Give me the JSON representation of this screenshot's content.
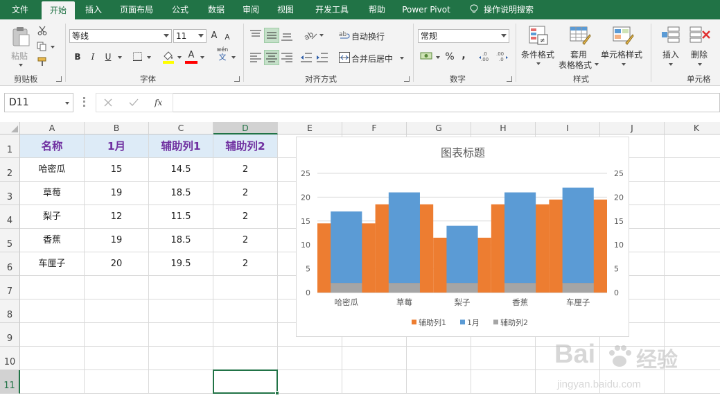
{
  "ribbon_tabs": [
    {
      "label": "文件",
      "active": false
    },
    {
      "label": "开始",
      "active": true
    },
    {
      "label": "插入",
      "active": false
    },
    {
      "label": "页面布局",
      "active": false
    },
    {
      "label": "公式",
      "active": false
    },
    {
      "label": "数据",
      "active": false
    },
    {
      "label": "审阅",
      "active": false
    },
    {
      "label": "视图",
      "active": false
    },
    {
      "label": "开发工具",
      "active": false
    },
    {
      "label": "帮助",
      "active": false
    },
    {
      "label": "Power Pivot",
      "active": false
    },
    {
      "label": "操作说明搜索",
      "active": false,
      "icon": "lightbulb-icon"
    }
  ],
  "ribbon": {
    "clipboard": {
      "label": "剪贴板",
      "paste": "粘贴"
    },
    "font": {
      "label": "字体",
      "name": "等线",
      "size": "11",
      "grow": "A",
      "shrink": "A",
      "bold": "B",
      "italic": "I",
      "underline": "U",
      "font_color_letter": "A",
      "phonetic": "文",
      "phonetic_top": "wén"
    },
    "alignment": {
      "label": "对齐方式",
      "wrap_text": "自动换行",
      "merge_center": "合并后居中"
    },
    "number": {
      "label": "数字",
      "format": "常规",
      "percent": "%",
      "comma": ","
    },
    "styles": {
      "label": "样式",
      "conditional": "条件格式",
      "table_format_1": "套用",
      "table_format_2": "表格格式",
      "cell_styles": "单元格样式"
    },
    "cells": {
      "label": "单元格",
      "insert": "插入",
      "delete": "删除"
    }
  },
  "formula_bar": {
    "name_box": "D11",
    "formula": ""
  },
  "columns": [
    "A",
    "B",
    "C",
    "D",
    "E",
    "F",
    "G",
    "H",
    "I",
    "J",
    "K"
  ],
  "selected_column": "D",
  "rows": [
    "1",
    "2",
    "3",
    "4",
    "5",
    "6",
    "7",
    "8",
    "9",
    "10",
    "11"
  ],
  "selected_row": "11",
  "active_cell": "D11",
  "table": {
    "headers": [
      "名称",
      "1月",
      "辅助列1",
      "辅助列2"
    ],
    "rows": [
      [
        "哈密瓜",
        "15",
        "14.5",
        "2"
      ],
      [
        "草莓",
        "19",
        "18.5",
        "2"
      ],
      [
        "梨子",
        "12",
        "11.5",
        "2"
      ],
      [
        "香蕉",
        "19",
        "18.5",
        "2"
      ],
      [
        "车厘子",
        "20",
        "19.5",
        "2"
      ]
    ]
  },
  "colors": {
    "excel_green": "#217346",
    "header_fill": "#ddebf7",
    "header_text": "#7030a0",
    "orange": "#ed7d31",
    "blue": "#5b9bd5",
    "gray": "#a5a5a5"
  },
  "chart_data": {
    "type": "bar",
    "title": "图表标题",
    "categories": [
      "哈密瓜",
      "草莓",
      "梨子",
      "香蕉",
      "车厘子"
    ],
    "series": [
      {
        "name": "辅助列1",
        "values": [
          14.5,
          18.5,
          11.5,
          18.5,
          19.5
        ],
        "color": "#ed7d31",
        "axis": "secondary"
      },
      {
        "name": "1月",
        "values": [
          15,
          19,
          12,
          19,
          20
        ],
        "color": "#5b9bd5",
        "axis": "primary"
      },
      {
        "name": "辅助列2",
        "values": [
          2,
          2,
          2,
          2,
          2
        ],
        "color": "#a5a5a5",
        "axis": "primary"
      }
    ],
    "ylim": [
      0,
      25
    ],
    "y_ticks": [
      "0",
      "5",
      "10",
      "15",
      "20",
      "25"
    ],
    "y2_ticks": [
      "0",
      "5",
      "10",
      "15",
      "20",
      "25"
    ],
    "grid": true,
    "legend": "bottom"
  },
  "watermark": {
    "brand": "Bai",
    "brand2": "经验",
    "url": "jingyan.baidu.com"
  }
}
